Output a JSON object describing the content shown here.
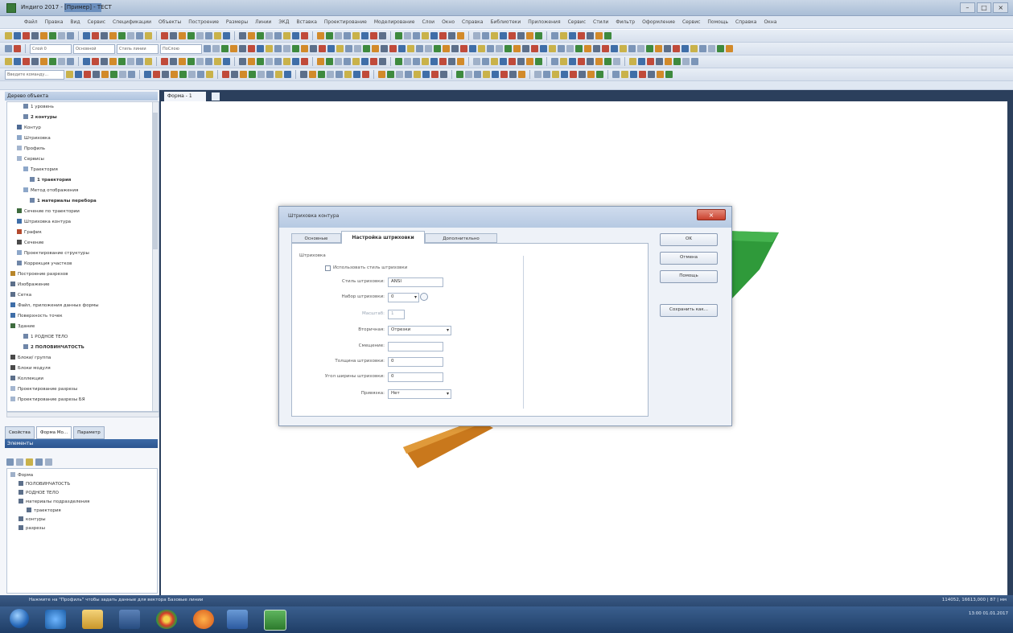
{
  "window": {
    "title": "Индиго 2017 - [Пример] - ТЕСТ",
    "buttons": [
      "–",
      "□",
      "×"
    ]
  },
  "menu": [
    "Файл",
    "Правка",
    "Вид",
    "Сервис",
    "Спецификации",
    "Объекты",
    "Построение",
    "Размеры",
    "Линии",
    "ЭКД",
    "Вставка",
    "Проектирование",
    "Моделирование",
    "Слои",
    "Окно",
    "Справка",
    "Библиотеки",
    "Приложения",
    "Сервис",
    "Стили",
    "Фильтр",
    "Оформление",
    "Сервис",
    "Помощь",
    "Справка",
    "Окна"
  ],
  "toolbar": {
    "combo1": "Слой 0",
    "combo2": "Основной",
    "combo3": "Стиль линии",
    "combo4": "ПоСлою",
    "search_placeholder": "Введите команду..."
  },
  "object_tree": {
    "header": "Дерево объекта",
    "items": [
      {
        "label": "1 уровень",
        "bold": false,
        "indent": 2,
        "color": "#6f86a8"
      },
      {
        "label": "2 контуры",
        "bold": true,
        "indent": 2,
        "color": "#6f86a8"
      },
      {
        "label": "Контур",
        "bold": false,
        "indent": 1,
        "color": "#4d6a94"
      },
      {
        "label": "Штриховка",
        "bold": false,
        "indent": 1,
        "color": "#8da7c9"
      },
      {
        "label": "Профиль",
        "bold": false,
        "indent": 1,
        "color": "#a3b5cf"
      },
      {
        "label": "Сервисы",
        "bold": false,
        "indent": 1,
        "color": "#a3b5cf"
      },
      {
        "label": "Траектория",
        "bold": false,
        "indent": 2,
        "color": "#8da7c9"
      },
      {
        "label": "1 траектория",
        "bold": true,
        "indent": 3,
        "color": "#6f86a8"
      },
      {
        "label": "Метод отображения",
        "bold": false,
        "indent": 2,
        "color": "#8da7c9"
      },
      {
        "label": "1 материалы перебора",
        "bold": true,
        "indent": 3,
        "color": "#6f86a8"
      },
      {
        "label": "Сечение по траектории",
        "bold": false,
        "indent": 1,
        "color": "#3e6b3e"
      },
      {
        "label": "Штриховка контура",
        "bold": false,
        "indent": 1,
        "color": "#3f6ea8"
      },
      {
        "label": "График",
        "bold": false,
        "indent": 1,
        "color": "#b34a2e"
      },
      {
        "label": "Сечение",
        "bold": false,
        "indent": 1,
        "color": "#4a4a4a"
      },
      {
        "label": "Проектирование структуры",
        "bold": false,
        "indent": 1,
        "color": "#8da7c9"
      },
      {
        "label": "Коррекция участков",
        "bold": false,
        "indent": 1,
        "color": "#6f86a8"
      },
      {
        "label": "Построение разрезов",
        "bold": false,
        "indent": 0,
        "color": "#b8862b"
      },
      {
        "label": "Изображение",
        "bold": false,
        "indent": 0,
        "color": "#5c6f8a"
      },
      {
        "label": "Сетка",
        "bold": false,
        "indent": 0,
        "color": "#5c6f8a"
      },
      {
        "label": "Файл, приложения данных формы",
        "bold": false,
        "indent": 0,
        "color": "#3f6ea8"
      },
      {
        "label": "Поверхность точек",
        "bold": false,
        "indent": 0,
        "color": "#3f6ea8"
      },
      {
        "label": "Здание",
        "bold": false,
        "indent": 0,
        "color": "#3e6b3e"
      },
      {
        "label": "1 РОДНОЕ ТЕЛО",
        "bold": false,
        "indent": 2,
        "color": "#6f86a8"
      },
      {
        "label": "2 ПОЛОВИНЧАТОСТЬ",
        "bold": true,
        "indent": 2,
        "color": "#6f86a8"
      },
      {
        "label": "Блоки/ группа",
        "bold": false,
        "indent": 0,
        "color": "#4a4a4a"
      },
      {
        "label": "Блоки модуля",
        "bold": false,
        "indent": 0,
        "color": "#4a4a4a"
      },
      {
        "label": "Коллекции",
        "bold": false,
        "indent": 0,
        "color": "#5c6f8a"
      },
      {
        "label": "Проектирование разрезы",
        "bold": false,
        "indent": 0,
        "color": "#a3b5cf"
      },
      {
        "label": "Проектирование разрезы БЯ",
        "bold": false,
        "indent": 0,
        "color": "#a3b5cf"
      }
    ]
  },
  "panel_tabs": [
    "Свойства",
    "Форма Мо...",
    "Параметр"
  ],
  "layers": {
    "header": "Элементы",
    "items": [
      {
        "label": "Форма",
        "indent": 0
      },
      {
        "label": "ПОЛОВИНЧАТОСТЬ",
        "indent": 1
      },
      {
        "label": "РОДНОЕ ТЕЛО",
        "indent": 1
      },
      {
        "label": "материалы подразделения",
        "indent": 1
      },
      {
        "label": "траектория",
        "indent": 2
      },
      {
        "label": "контуры",
        "indent": 1
      },
      {
        "label": "разрезы",
        "indent": 1
      }
    ]
  },
  "document": {
    "tab_label": "Форма - 1"
  },
  "dialog": {
    "title": "Штриховка контура",
    "close_label": "×",
    "tabs": [
      "Основные",
      "Настройка штриховки",
      "Дополнительно"
    ],
    "group_label": "Штриховка",
    "checkbox_label": "Использовать стиль штриховки",
    "fields": [
      {
        "label": "Стиль штриховки:",
        "value": "ANSI",
        "type": "input"
      },
      {
        "label": "Набор штриховки:",
        "value": "0",
        "type": "combo"
      },
      {
        "label": "Масштаб:",
        "value": "1",
        "type": "input"
      },
      {
        "label": "Вторичная:",
        "value": "Отрезки",
        "type": "combo"
      },
      {
        "label": "Смещение:",
        "value": "",
        "type": "input"
      },
      {
        "label": "Толщина штриховки:",
        "value": "0",
        "type": "input"
      },
      {
        "label": "Угол ширины штриховки:",
        "value": "0",
        "type": "input"
      },
      {
        "label": "Привязка:",
        "value": "Нет",
        "type": "combo"
      }
    ],
    "buttons": [
      "OK",
      "Отмена",
      "Помощь",
      "Сохранить как..."
    ]
  },
  "status": {
    "left": "Нажмите на \"Профиль\" чтобы задать данные для вектора Базовые линии",
    "right": "114052, 16613,000 | 87 | мм"
  },
  "tray": {
    "time": "13:00",
    "date": "01.01.2017"
  },
  "colors": {
    "titlebar": "#b6c9e2",
    "panel_border": "#2b3f5c",
    "green_shape": "#2f9a3a",
    "orange_shape": "#c9781c",
    "close_button": "#c9412d"
  }
}
